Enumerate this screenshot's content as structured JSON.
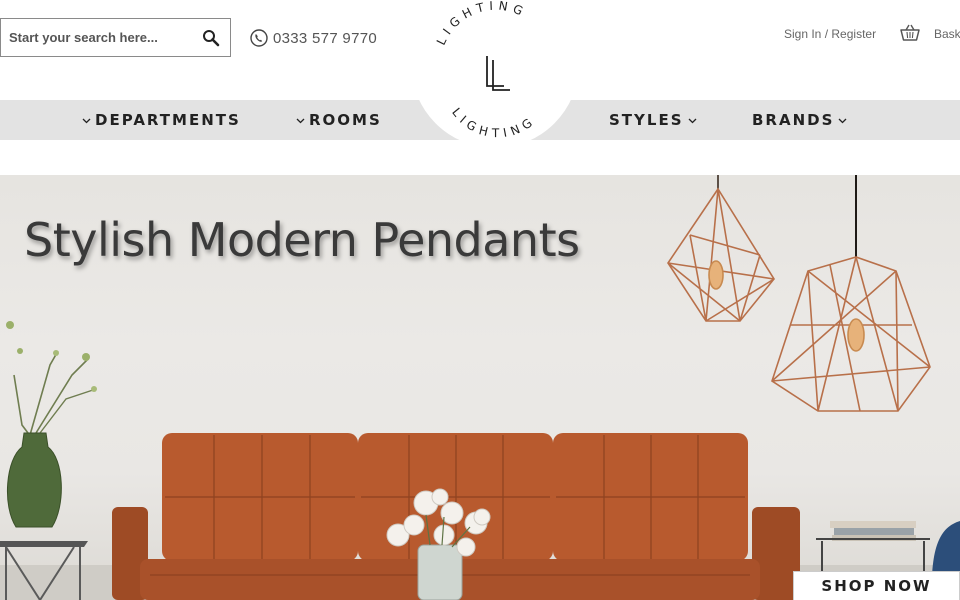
{
  "header": {
    "search": {
      "placeholder": "Start your search here..."
    },
    "phone": "0333 577 9770",
    "sign_in": "Sign In",
    "separator": "/",
    "register": "Register",
    "basket": "Basket"
  },
  "logo": {
    "top_text": "LIGHTING",
    "bottom_text": "LIGHTING"
  },
  "nav": {
    "items": [
      {
        "label": "DEPARTMENTS"
      },
      {
        "label": "ROOMS"
      },
      {
        "label": "STYLES"
      },
      {
        "label": "BRANDS"
      }
    ]
  },
  "hero": {
    "title": "Stylish Modern Pendants",
    "cta": "SHOP NOW"
  },
  "colors": {
    "nav_bg": "#e3e3e3",
    "sofa": "#b85a2e",
    "copper": "#b8704a",
    "vase": "#4f6a3a"
  },
  "icons": [
    "search-icon",
    "phone-icon",
    "basket-icon",
    "chevron-down-icon"
  ]
}
